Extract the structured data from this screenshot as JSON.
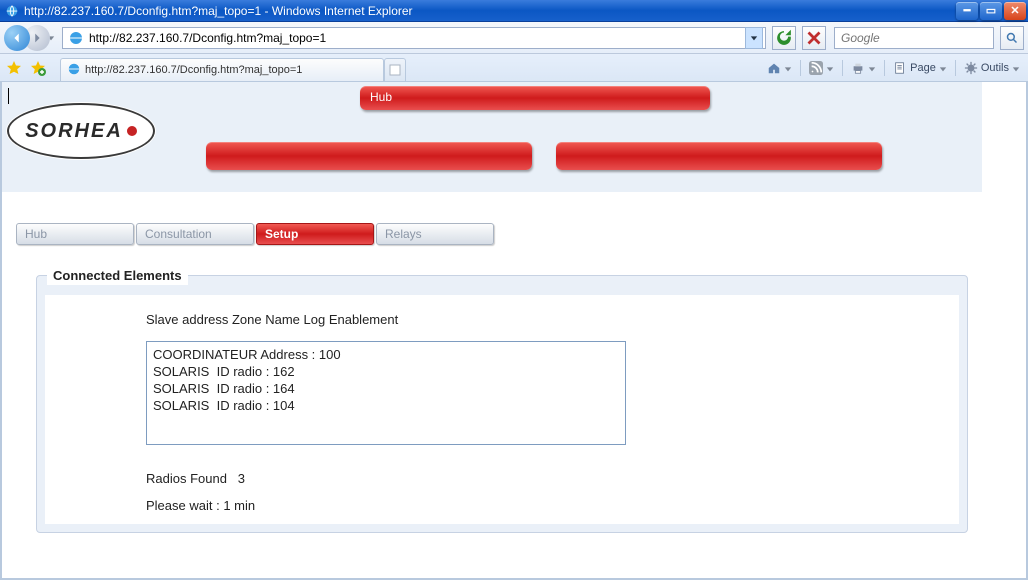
{
  "window": {
    "title": "http://82.237.160.7/Dconfig.htm?maj_topo=1 - Windows Internet Explorer"
  },
  "address_bar": {
    "url": "http://82.237.160.7/Dconfig.htm?maj_topo=1"
  },
  "search": {
    "placeholder": "Google"
  },
  "doc_tab": {
    "label": "http://82.237.160.7/Dconfig.htm?maj_topo=1"
  },
  "toolbar": {
    "page_label": "Page",
    "tools_label": "Outils"
  },
  "logo": {
    "text": "SORHEA"
  },
  "topbars": {
    "hub_label": "Hub"
  },
  "subnav": {
    "items": [
      {
        "label": "Hub"
      },
      {
        "label": "Consultation"
      },
      {
        "label": "Setup"
      },
      {
        "label": "Relays"
      }
    ],
    "active_index": 2
  },
  "panel": {
    "legend": "Connected Elements",
    "columns_header": "Slave address Zone Name Log Enablement",
    "list_items": [
      "COORDINATEUR Address : 100",
      "SOLARIS  ID radio : 162",
      "SOLARIS  ID radio : 164",
      "SOLARIS  ID radio : 104"
    ],
    "radios_found_label": "Radios Found",
    "radios_found_value": "3",
    "wait_label": "Please wait :",
    "wait_value": "1 min"
  }
}
